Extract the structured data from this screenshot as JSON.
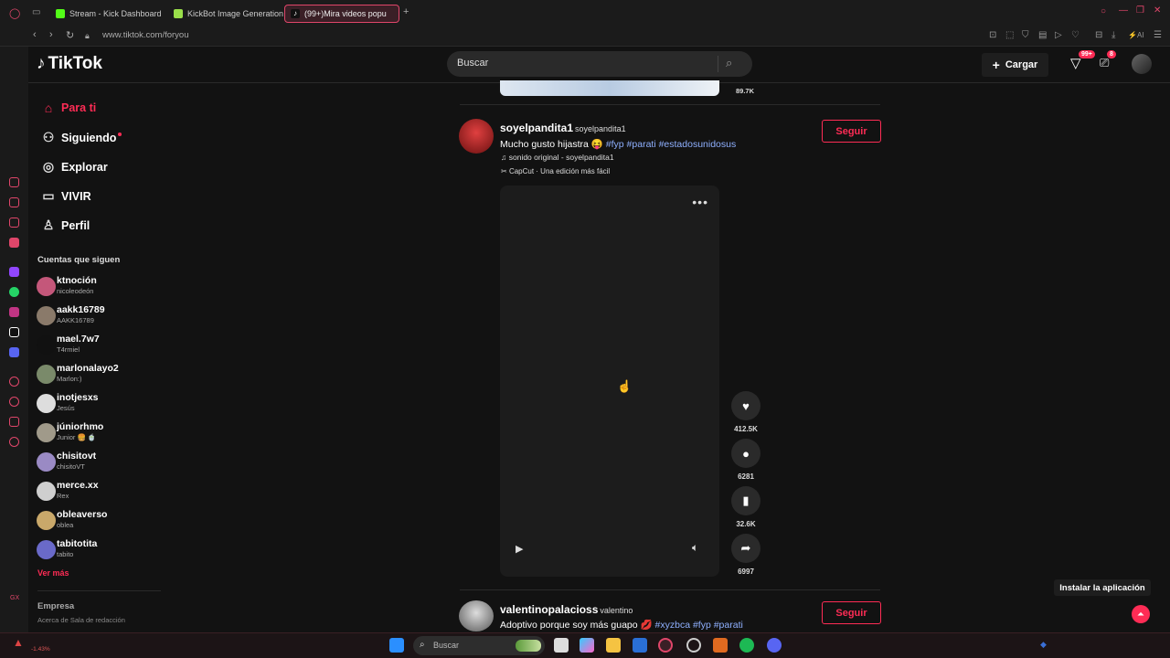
{
  "browser": {
    "tabs": [
      {
        "label": "Stream - Kick Dashboard",
        "active": false
      },
      {
        "label": "KickBot Image Generation",
        "active": false
      },
      {
        "label": "(99+)Mira videos popu",
        "active": true
      }
    ],
    "url": "www.tiktok.com/foryou"
  },
  "header": {
    "logo": "TikTok",
    "search_placeholder": "Buscar",
    "upload_label": "Cargar",
    "inbox_badge": "99+",
    "messages_badge": "8"
  },
  "nav": {
    "items": [
      {
        "label": "Para ti",
        "icon": "home-icon"
      },
      {
        "label": "Siguiendo",
        "icon": "following-icon"
      },
      {
        "label": "Explorar",
        "icon": "compass-icon"
      },
      {
        "label": "VIVIR",
        "icon": "live-icon"
      },
      {
        "label": "Perfil",
        "icon": "profile-icon"
      }
    ],
    "following_header": "Cuentas que siguen",
    "accounts": [
      {
        "name": "ktnoción",
        "sub": "nicoleodeón"
      },
      {
        "name": "aakk16789",
        "sub": "AAKK16789"
      },
      {
        "name": "mael.7w7",
        "sub": "T4rmiel"
      },
      {
        "name": "marlonalayo2",
        "sub": "Marlon:)"
      },
      {
        "name": "inotjesxs",
        "sub": "Jesús"
      },
      {
        "name": "júniorhmo",
        "sub": "Junior 🍔 🍵"
      },
      {
        "name": "chisitovt",
        "sub": "chisitoVT"
      },
      {
        "name": "merce.xx",
        "sub": "Rex"
      },
      {
        "name": "obleaverso",
        "sub": "oblea"
      },
      {
        "name": "tabitotita",
        "sub": "tabito"
      }
    ],
    "see_more": "Ver más",
    "company_header": "Empresa",
    "company_links": "Acerca de  Sala de redacción"
  },
  "feed": {
    "previous_count": "89.7K",
    "post1": {
      "username": "soyelpandita1",
      "nickname": "soyelpandita1",
      "caption": "Mucho gusto hijastra 😝",
      "tags": "#fyp #parati #estadosunidosus",
      "music": "♫ sonido original - soyelpandita1",
      "capcut": "CapCut · Una edición más fácil",
      "follow_label": "Seguir",
      "likes": "412.5K",
      "comments": "6281",
      "saves": "32.6K",
      "shares": "6997"
    },
    "post2": {
      "username": "valentinopalacioss",
      "nickname": "valentino",
      "caption": "Adoptivo porque soy más guapo 💋",
      "tags": "#xyzbca #fyp #parati",
      "follow_label": "Seguir"
    }
  },
  "install_app": "Instalar la aplicación",
  "taskbar": {
    "search_placeholder": "Buscar",
    "stock": "-1.43%"
  },
  "colors": {
    "brand": "#fe2c55",
    "background": "#121212"
  }
}
